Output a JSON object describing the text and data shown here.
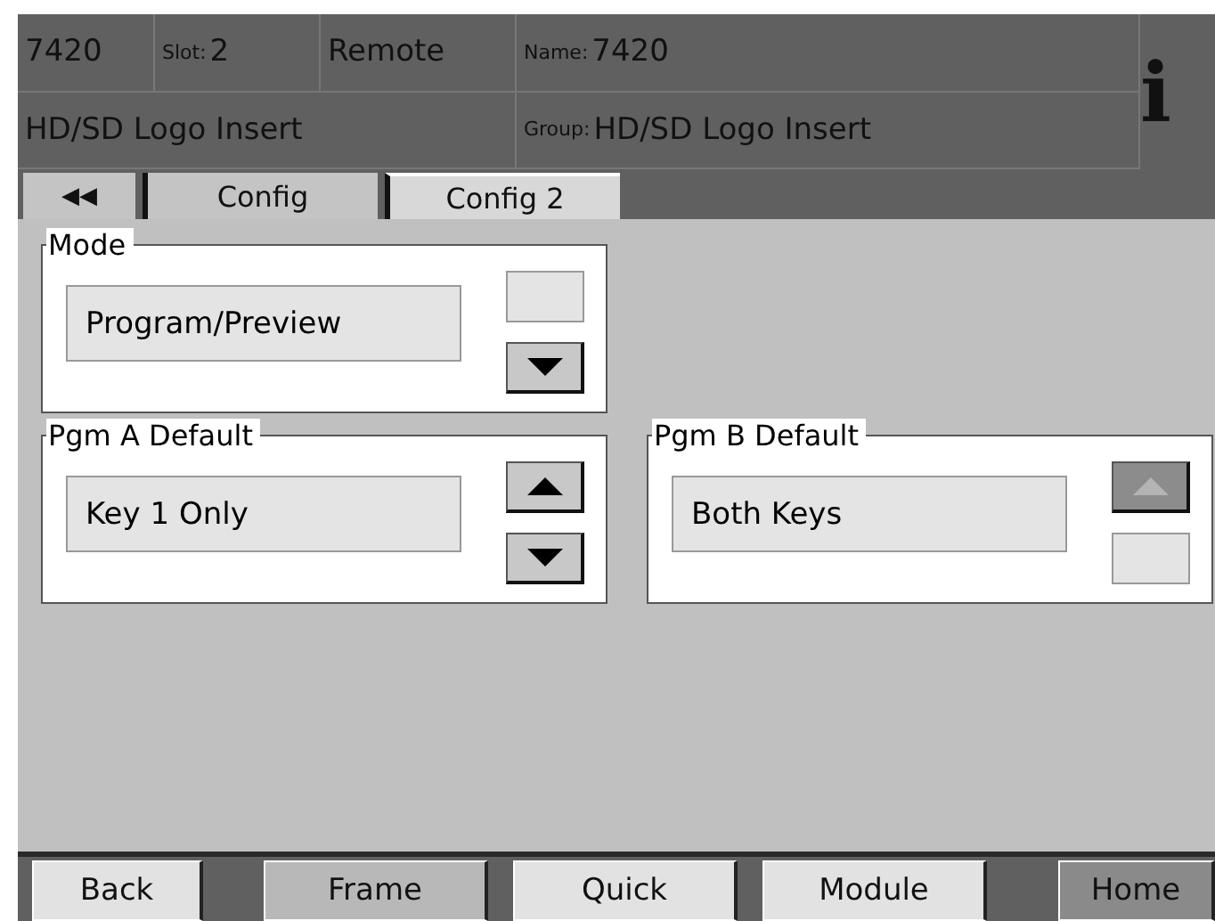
{
  "header": {
    "unit": "7420",
    "slot": {
      "label": "Slot:",
      "value": "2"
    },
    "mode": "Remote",
    "name": {
      "label": "Name:",
      "value": "7420"
    },
    "description": "HD/SD Logo Insert",
    "group": {
      "label": "Group:",
      "value": "HD/SD Logo Insert"
    },
    "info": "i"
  },
  "tabs": [
    {
      "label": "◀◀",
      "selected": false
    },
    {
      "label": "Config",
      "selected": false
    },
    {
      "label": "Config 2",
      "selected": true
    }
  ],
  "panels": [
    {
      "title": "Mode",
      "value": "Program/Preview",
      "up": {
        "visible": false
      },
      "down": {
        "visible": true,
        "disabled": false
      }
    },
    {
      "title": "Pgm A Default",
      "value": "Key 1 Only",
      "up": {
        "visible": true,
        "disabled": false
      },
      "down": {
        "visible": true,
        "disabled": false
      }
    },
    {
      "title": "Pgm B Default",
      "value": "Both Keys",
      "up": {
        "visible": true,
        "disabled": true
      },
      "down": {
        "visible": false
      }
    }
  ],
  "buttons": [
    {
      "label": "Back",
      "kind": "light"
    },
    {
      "label": "Frame",
      "kind": "mid"
    },
    {
      "label": "Quick",
      "kind": "light"
    },
    {
      "label": "Module",
      "kind": "light"
    },
    {
      "label": "Home",
      "kind": "dark"
    }
  ]
}
